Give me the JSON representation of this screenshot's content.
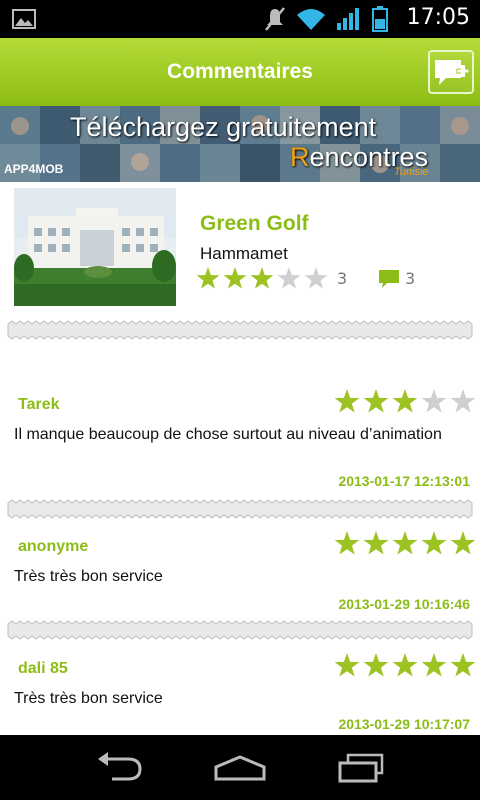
{
  "status_bar": {
    "time": "17:05",
    "icons": [
      "gallery-icon",
      "mute-icon",
      "wifi-icon",
      "signal-icon",
      "battery-icon"
    ]
  },
  "action_bar": {
    "title": "Commentaires",
    "add_comment_icon": "add-comment-icon"
  },
  "banner": {
    "line1": "Téléchargez gratuitement",
    "line2_initial": "R",
    "line2_rest": "encontres",
    "line3": "Tunisie",
    "logo": "APP4MOB"
  },
  "venue": {
    "name": "Green Golf",
    "city": "Hammamet",
    "rating": 3,
    "rating_max": 5,
    "rating_count": "3",
    "comment_count": "3"
  },
  "comments": [
    {
      "author": "Tarek",
      "rating": 3,
      "text": "Il manque beaucoup de chose surtout au niveau d’animation",
      "date": "2013-01-17 12:13:01"
    },
    {
      "author": "anonyme",
      "rating": 5,
      "text": "Très très bon service",
      "date": "2013-01-29 10:16:46"
    },
    {
      "author": "dali 85",
      "rating": 5,
      "text": "Très très bon service",
      "date": "2013-01-29 10:17:07"
    }
  ],
  "colors": {
    "accent": "#8cbd16",
    "star_on": "#9cc321",
    "star_off": "#cfcfcf",
    "action_bar": "#9ccb1e"
  },
  "nav_bar": {
    "icons": [
      "back-icon",
      "home-icon",
      "recent-apps-icon"
    ]
  }
}
